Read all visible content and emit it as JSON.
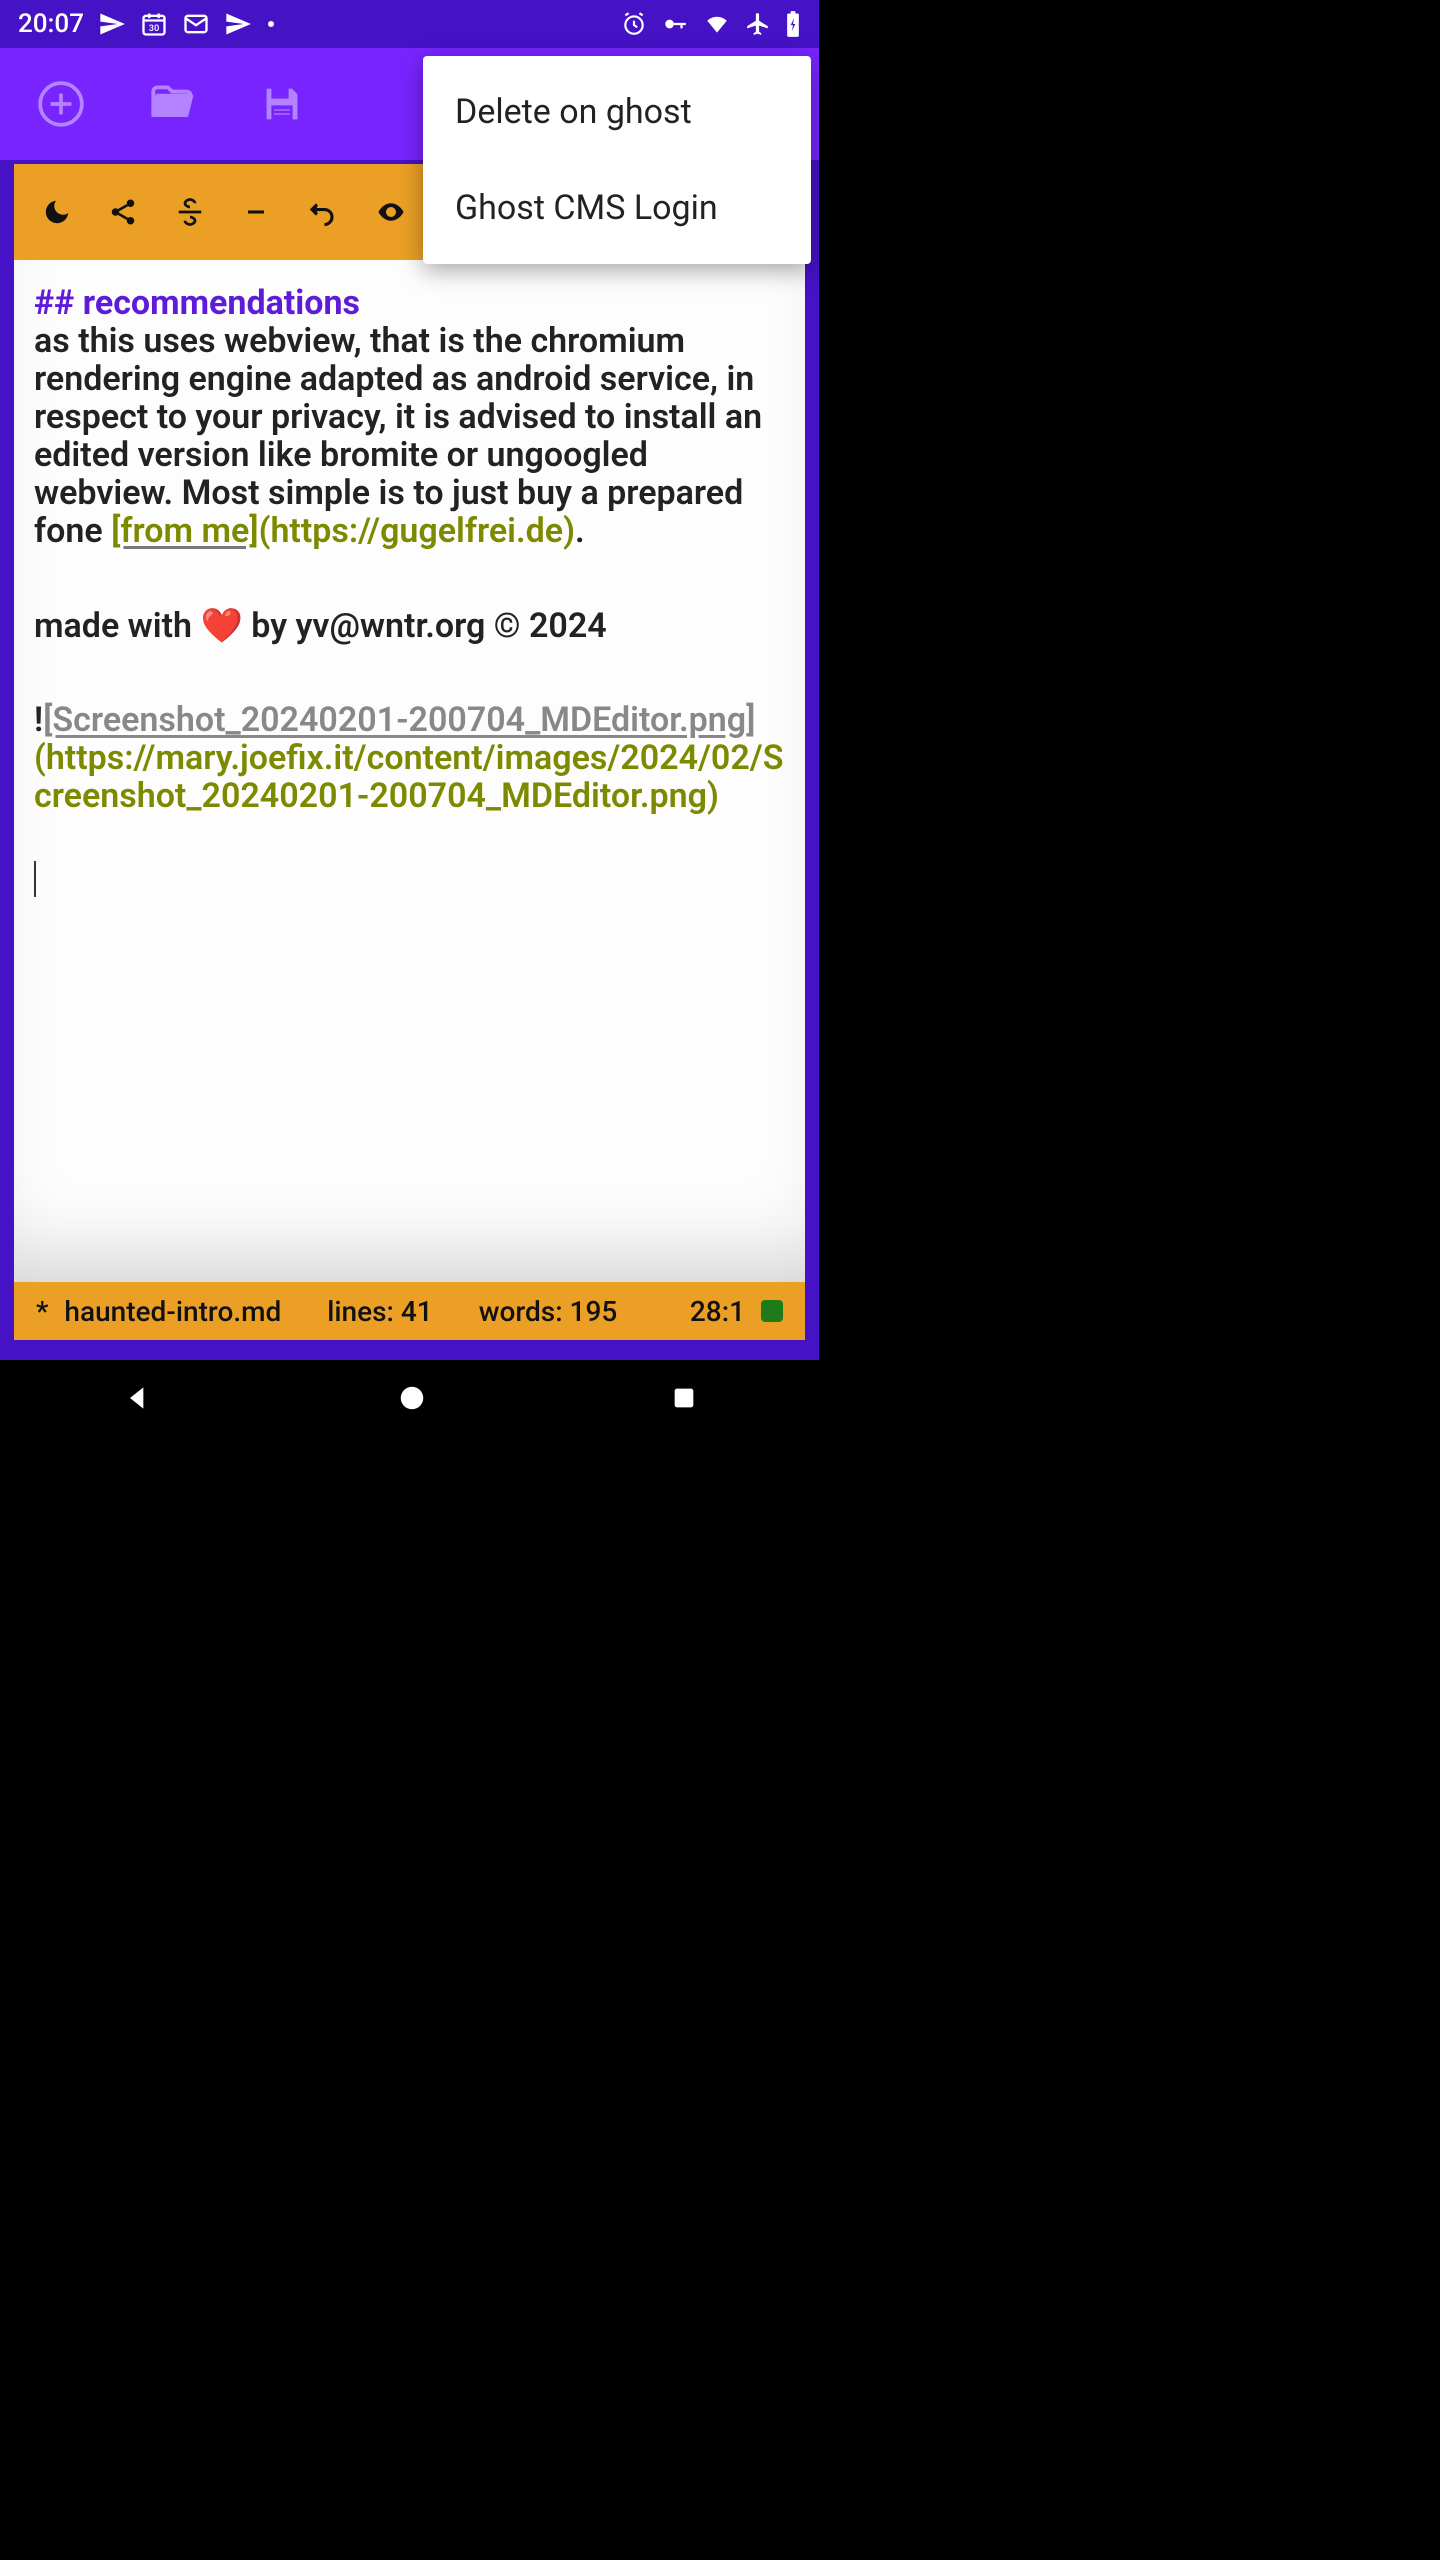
{
  "statusbar": {
    "time": "20:07"
  },
  "popup": {
    "items": [
      {
        "label": "Delete on ghost"
      },
      {
        "label": "Ghost CMS Login"
      }
    ]
  },
  "editor": {
    "heading": "## recommendations",
    "body1": "as this uses webview, that is the chromium rendering engine adapted as android service, in respect to your privacy, it is advised to install an edited version like bromite or ungoogled webview. Most simple is to just buy a prepared fone ",
    "link_label": "[from me]",
    "link_url": "(https://gugelfrei.de)",
    "body1_end": ".",
    "signature": "made with ❤️ by yv@wntr.org © 2024",
    "image_bang": "!",
    "image_label": "[Screenshot_20240201-200704_MDEditor.png]",
    "image_url": "(https://mary.joefix.it/content/images/2024/02/Screenshot_20240201-200704_MDEditor.png)"
  },
  "footer": {
    "dirty": "*",
    "filename": "haunted-intro.md",
    "lines_label": "lines: 41",
    "words_label": "words: 195",
    "cursor": "28:1"
  }
}
